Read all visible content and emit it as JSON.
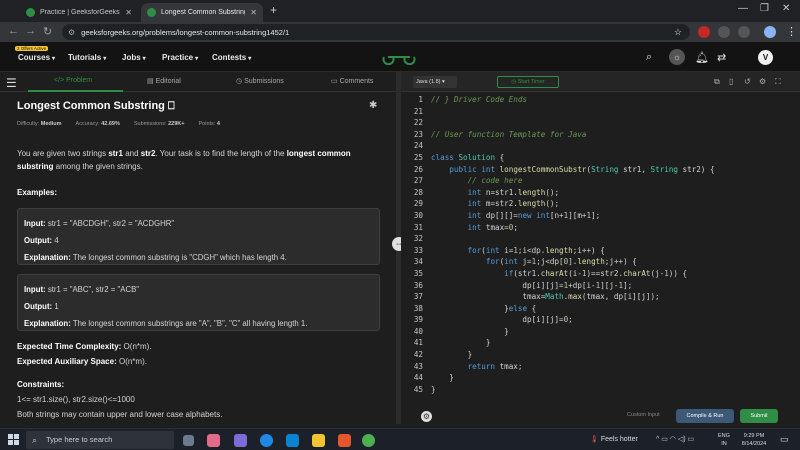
{
  "browser": {
    "tabs": [
      {
        "title": "Practice | GeeksforGeeks | A co"
      },
      {
        "title": "Longest Common Substring | P"
      }
    ],
    "url": "geeksforgeeks.org/problems/longest-common-substring1452/1"
  },
  "site_nav": {
    "offers_badge": "2 Offers Active",
    "items": [
      "Courses",
      "Tutorials",
      "Jobs",
      "Practice",
      "Contests"
    ],
    "avatar_letter": "V"
  },
  "left_tabs": [
    "</> Problem",
    "Editorial",
    "Submissions",
    "Comments"
  ],
  "problem": {
    "title": "Longest Common Substring",
    "difficulty_label": "Difficulty:",
    "difficulty": "Medium",
    "accuracy_label": "Accuracy:",
    "accuracy": "42.69%",
    "submissions_label": "Submissions:",
    "submissions": "229K+",
    "points_label": "Points:",
    "points": "4",
    "desc_pre": "You are given two strings ",
    "desc_s1": "str1",
    "desc_and": " and ",
    "desc_s2": "str2",
    "desc_mid": ". Your task is to find the length of the ",
    "desc_bold": "longest common substring",
    "desc_post": " among the given strings.",
    "examples_heading": "Examples:",
    "examples": [
      {
        "input_label": "Input:",
        "input": " str1 = \"ABCDGH\", str2 = \"ACDGHR\"",
        "output_label": "Output:",
        "output": "  4",
        "explanation_label": "Explanation:",
        "explanation": " The longest common substring is \"CDGH\" which has length 4."
      },
      {
        "input_label": "Input:",
        "input": " str1 = \"ABC\", str2 = \"ACB\"",
        "output_label": "Output:",
        "output": "  1",
        "explanation_label": "Explanation:",
        "explanation": " The longest common substrings are \"A\", \"B\", \"C\" all having length 1."
      }
    ],
    "time_label": "Expected Time Complexity:",
    "time_value": " O(n*m).",
    "space_label": "Expected Auxiliary Space:",
    "space_value": " O(n*m).",
    "constraints_heading": "Constraints:",
    "constraint1": "1<= str1.size(), str2.size()<=1000",
    "constraint2": "Both strings may contain upper and lower case alphabets."
  },
  "editor": {
    "language": "Java (1.8)",
    "timer_label": "Start Timer",
    "custom_input": "Custom Input",
    "compile_label": "Compile & Run",
    "submit_label": "Submit",
    "line_numbers": [
      "1",
      "21",
      "22",
      "23",
      "24",
      "25",
      "26",
      "27",
      "28",
      "29",
      "30",
      "31",
      "32",
      "33",
      "34",
      "35",
      "36",
      "37",
      "38",
      "39",
      "40",
      "41",
      "42",
      "43",
      "44",
      "45"
    ],
    "lines": [
      "// } Driver Code Ends",
      "",
      "",
      "// User function Template for Java",
      "",
      "class Solution {",
      "    public int longestCommonSubstr(String str1, String str2) {",
      "        // code here",
      "        int n=str1.length();",
      "        int m=str2.length();",
      "        int dp[][]=new int[n+1][m+1];",
      "        int tmax=0;",
      "",
      "        for(int i=1;i<dp.length;i++) {",
      "            for(int j=1;j<dp[0].length;j++) {",
      "                if(str1.charAt(i-1)==str2.charAt(j-1)) {",
      "                    dp[i][j]=1+dp[i-1][j-1];",
      "                    tmax=Math.max(tmax, dp[i][j]);",
      "                }else {",
      "                    dp[i][j]=0;",
      "                }",
      "            }",
      "        }",
      "        return tmax;",
      "    }",
      "}"
    ]
  },
  "taskbar": {
    "search_placeholder": "Type here to search",
    "weather": "Feels hotter",
    "lang1": "ENG",
    "lang2": "IN",
    "time": "9:29 PM",
    "date": "8/14/2024"
  },
  "colors": {
    "gfg_green": "#2f8d46",
    "background": "#1e1e1e"
  }
}
